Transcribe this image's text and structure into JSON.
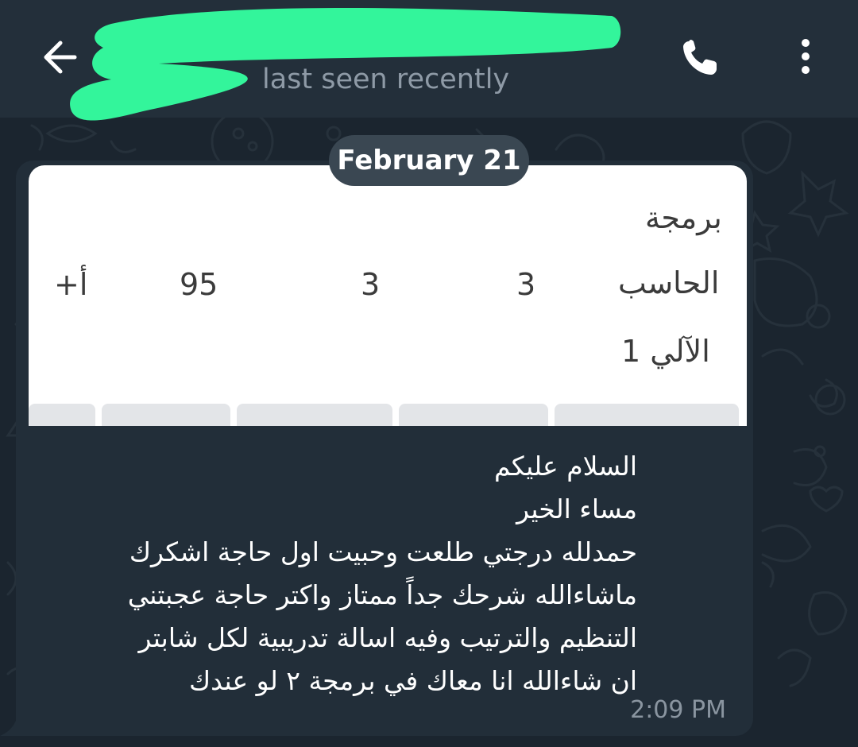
{
  "header": {
    "status": "last seen recently",
    "back_icon": "arrow-left-icon",
    "call_icon": "phone-icon",
    "menu_icon": "more-vertical-icon"
  },
  "date_separator": "February 21",
  "message": {
    "image_rows": {
      "row1_label": "برمجة",
      "row2_label": "الحاسب",
      "row2_value_a": "3",
      "row2_value_b": "3",
      "row2_value_c": "95",
      "row2_value_d": "+أ",
      "row3_label": "الآلي 1"
    },
    "lines": [
      "السلام عليكم",
      "مساء الخير",
      "حمدلله درجتي طلعت وحبيت اول حاجة اشكرك",
      "ماشاءالله شرحك جداً ممتاز واكتر حاجة عجبتني",
      "التنظيم والترتيب وفيه اسالة تدريبية لكل شابتر",
      "ان شاءالله انا معاك في برمجة ٢ لو عندك"
    ],
    "time": "2:09 PM"
  },
  "colors": {
    "background": "#1b252f",
    "header": "#232f3a",
    "bubble": "#222e39",
    "redaction": "#33f59b",
    "date_pill": "#3a4752"
  }
}
